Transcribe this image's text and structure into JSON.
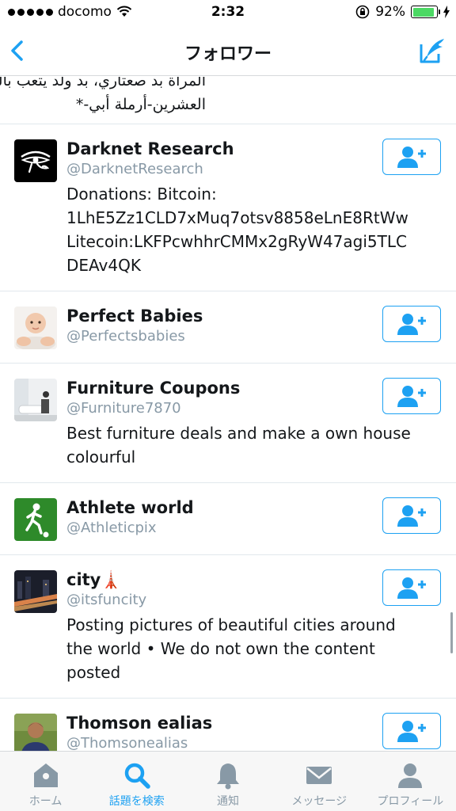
{
  "status_bar": {
    "carrier": "docomo",
    "time": "2:32",
    "battery_percent": "92%",
    "battery_level": 0.92,
    "battery_color": "#4cd964"
  },
  "nav": {
    "title": "フォロワー",
    "back_icon": "chevron-left-icon",
    "compose_icon": "compose-icon",
    "accent": "#1da1f2"
  },
  "partial_bio": {
    "line1": "المراة بد صعتاري، بد ولد يتعب بالحدثي بالرصور، الدلبية",
    "line2": "العشرين-أرملة أبي-*"
  },
  "users": [
    {
      "name": "Darknet Research",
      "handle": "@DarknetResearch",
      "bio": "Donations: Bitcoin:\n1LhE5Zz1CLD7xMuq7otsv8858eLnE8RtWw\nLitecoin:LKFPcwhhrCMMx2gRyW47agi5TLC\nDEAv4QK",
      "avatar": "eye-of-horus-logo"
    },
    {
      "name": "Perfect Babies",
      "handle": "@Perfectsbabies",
      "bio": "",
      "avatar": "baby-photo"
    },
    {
      "name": "Furniture Coupons",
      "handle": "@Furniture7870",
      "bio": "Best furniture deals and make a own house\ncolourful",
      "avatar": "furniture-photo"
    },
    {
      "name": "Athlete world",
      "handle": "@Athleticpix",
      "bio": "",
      "avatar": "soccer-player-logo"
    },
    {
      "name": "city🗼",
      "handle": "@itsfuncity",
      "bio": "Posting pictures of beautiful cities around\nthe world • We do not own the content\nposted",
      "avatar": "night-city-photo"
    },
    {
      "name": "Thomson ealias",
      "handle": "@Thomsonealias",
      "bio": "",
      "avatar": "person-photo"
    }
  ],
  "follow_icon": "add-user-icon",
  "tabs": [
    {
      "label": "ホーム",
      "icon": "home-icon",
      "active": false
    },
    {
      "label": "話題を検索",
      "icon": "search-icon",
      "active": true
    },
    {
      "label": "通知",
      "icon": "bell-icon",
      "active": false
    },
    {
      "label": "メッセージ",
      "icon": "envelope-icon",
      "active": false
    },
    {
      "label": "プロフィール",
      "icon": "person-icon",
      "active": false
    }
  ]
}
